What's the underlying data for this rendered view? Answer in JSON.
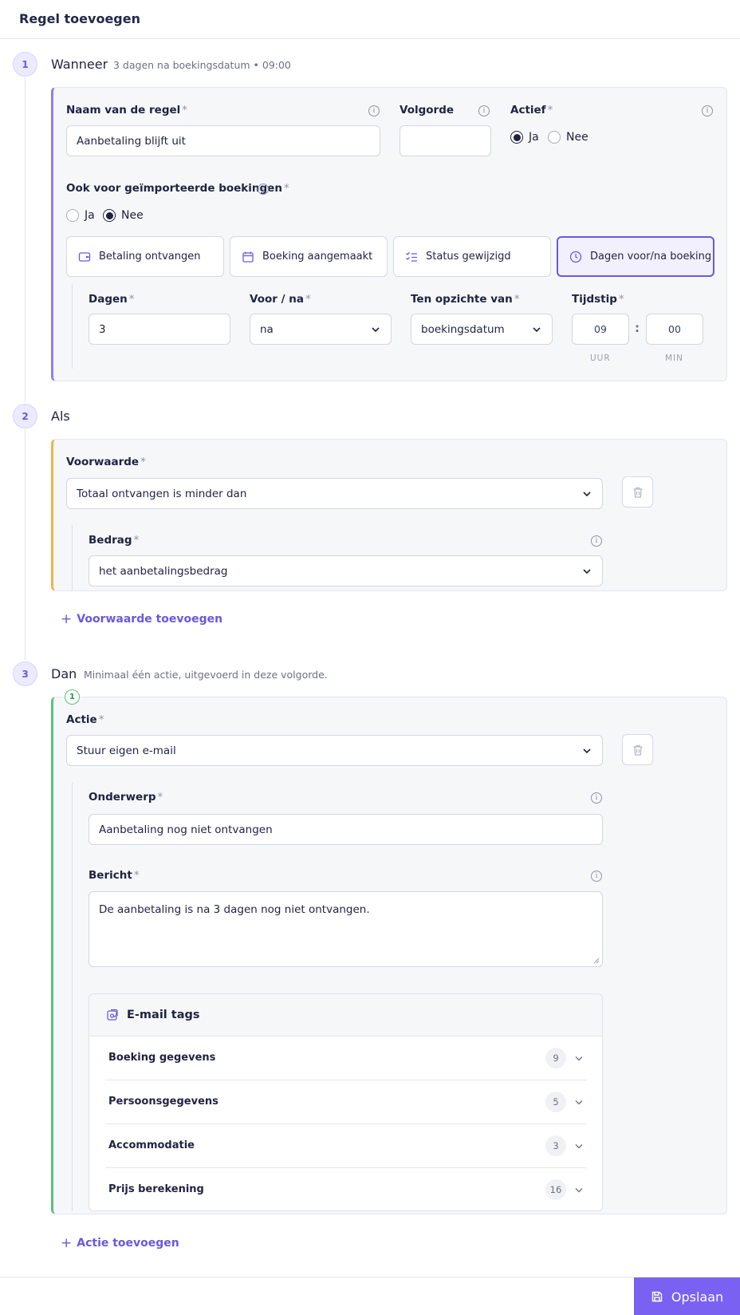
{
  "header": {
    "title": "Regel toevoegen"
  },
  "steps": {
    "when": {
      "number": "1",
      "title": "Wanneer",
      "summary": "3 dagen na boekingsdatum • 09:00",
      "name_label": "Naam van de regel",
      "name_value": "Aanbetaling blijft uit",
      "order_label": "Volgorde",
      "order_value": "",
      "active_label": "Actief",
      "active_options": [
        "Ja",
        "Nee"
      ],
      "active_selected": "Ja",
      "imported_label": "Ook voor geïmporteerde boekingen",
      "imported_options": [
        "Ja",
        "Nee"
      ],
      "imported_selected": "Nee",
      "triggers": [
        "Betaling ontvangen",
        "Boeking aangemaakt",
        "Status gewijzigd",
        "Dagen voor/na boeking"
      ],
      "active_trigger": "Dagen voor/na boeking",
      "days_label": "Dagen",
      "days_value": "3",
      "direction_label": "Voor / na",
      "direction_value": "na",
      "relative_label": "Ten opzichte van",
      "relative_value": "boekingsdatum",
      "time_label": "Tijdstip",
      "hour_value": "09",
      "minute_value": "00",
      "hour_caption": "UUR",
      "minute_caption": "MIN",
      "time_separator": ":"
    },
    "if": {
      "number": "2",
      "title": "Als",
      "condition_label": "Voorwaarde",
      "condition_value": "Totaal ontvangen is minder dan",
      "amount_label": "Bedrag",
      "amount_value": "het aanbetalingsbedrag",
      "add_condition": "Voorwaarde toevoegen"
    },
    "then": {
      "number": "3",
      "title": "Dan",
      "summary": "Minimaal één actie, uitgevoerd in deze volgorde.",
      "action_index": "1",
      "action_label": "Actie",
      "action_value": "Stuur eigen e-mail",
      "subject_label": "Onderwerp",
      "subject_value": "Aanbetaling nog niet ontvangen",
      "message_label": "Bericht",
      "message_value": "De aanbetaling is na 3 dagen nog niet ontvangen.",
      "tags_title": "E-mail tags",
      "tag_groups": [
        {
          "name": "Boeking gegevens",
          "count": "9"
        },
        {
          "name": "Persoonsgegevens",
          "count": "5"
        },
        {
          "name": "Accommodatie",
          "count": "3"
        },
        {
          "name": "Prijs berekening",
          "count": "16"
        }
      ],
      "add_action": "Actie toevoegen"
    }
  },
  "footer": {
    "save_label": "Opslaan"
  },
  "colors": {
    "accent": "#7b61f2",
    "when_border": "#8d7ef0",
    "if_border": "#f2b24d",
    "then_border": "#5cc17d"
  },
  "required_marker": "*"
}
